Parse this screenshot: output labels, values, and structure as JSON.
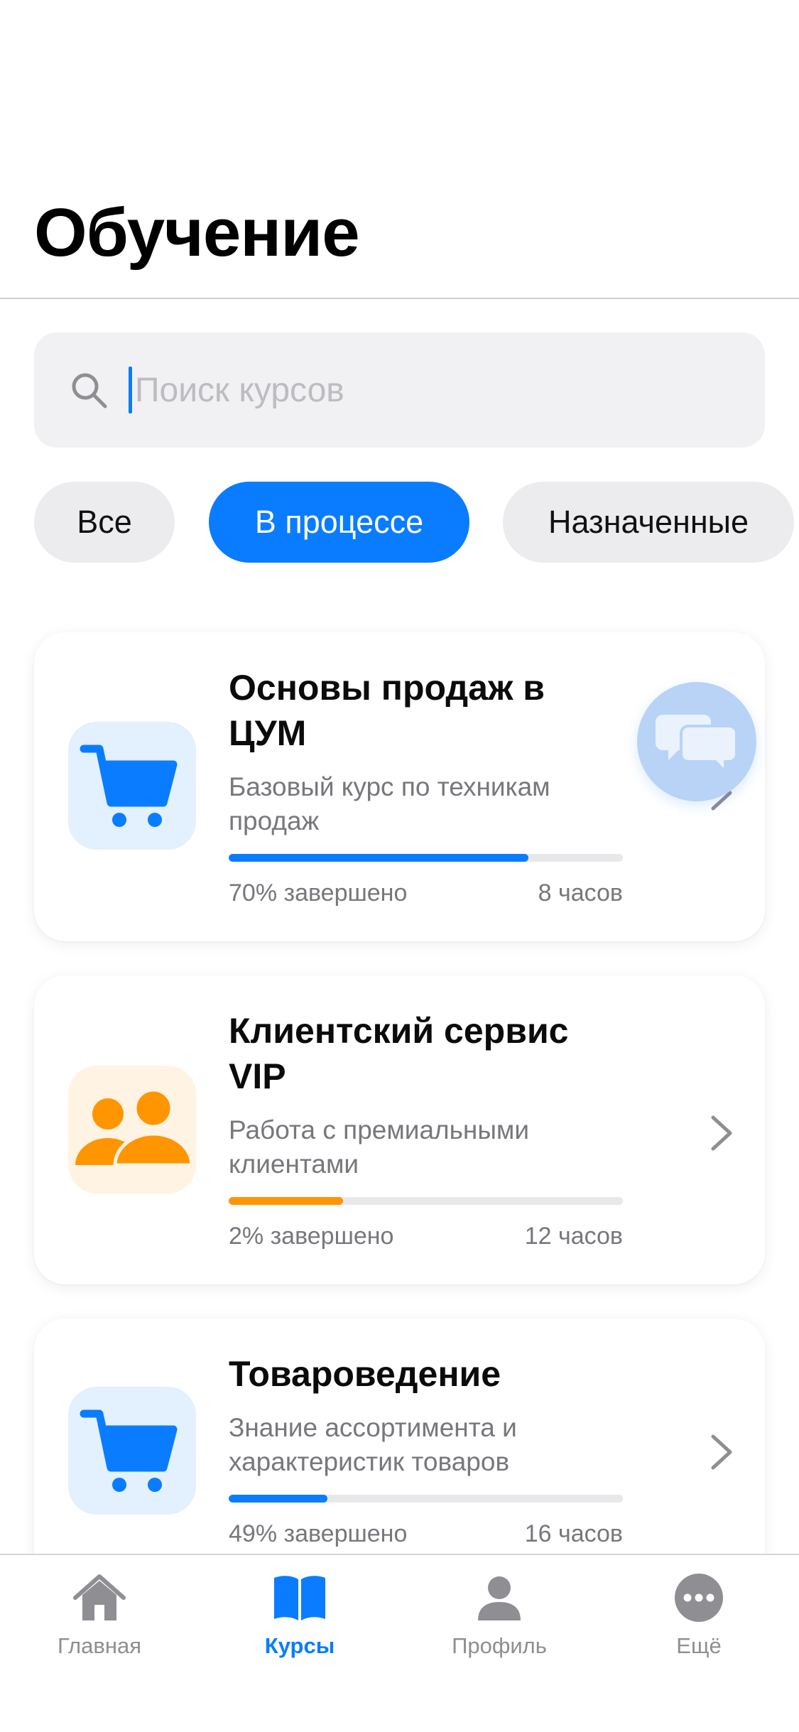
{
  "header": {
    "title": "Обучение"
  },
  "search": {
    "placeholder": "Поиск курсов",
    "value": ""
  },
  "filters": [
    {
      "label": "Все",
      "active": false
    },
    {
      "label": "В процессе",
      "active": true
    },
    {
      "label": "Назначенные",
      "active": false
    }
  ],
  "courses": [
    {
      "title": "Основы продаж в ЦУМ",
      "subtitle": "Базовый курс по техникам продаж",
      "progress_text": "70% завершено",
      "progress": 0.76,
      "duration": "8 часов",
      "icon": "cart-icon",
      "accent": "#0a7cff"
    },
    {
      "title": "Клиентский сервис VIP",
      "subtitle": "Работа с премиальными клиентами",
      "progress_text": "2% завершено",
      "progress": 0.29,
      "duration": "12 часов",
      "icon": "users-icon",
      "accent": "#ff9500"
    },
    {
      "title": "Товароведение",
      "subtitle": "Знание ассортимента и характеристик товаров",
      "progress_text": "49% завершено",
      "progress": 0.25,
      "duration": "16 часов",
      "icon": "cart-icon",
      "accent": "#0a7cff"
    }
  ],
  "tabbar": [
    {
      "label": "Главная",
      "icon": "home-icon",
      "active": false
    },
    {
      "label": "Курсы",
      "icon": "book-icon",
      "active": true
    },
    {
      "label": "Профиль",
      "icon": "person-icon",
      "active": false
    },
    {
      "label": "Ещё",
      "icon": "more-icon",
      "active": false
    }
  ],
  "colors": {
    "accent": "#0a7cff",
    "orange": "#ff9500",
    "gray": "#8e8e93"
  }
}
